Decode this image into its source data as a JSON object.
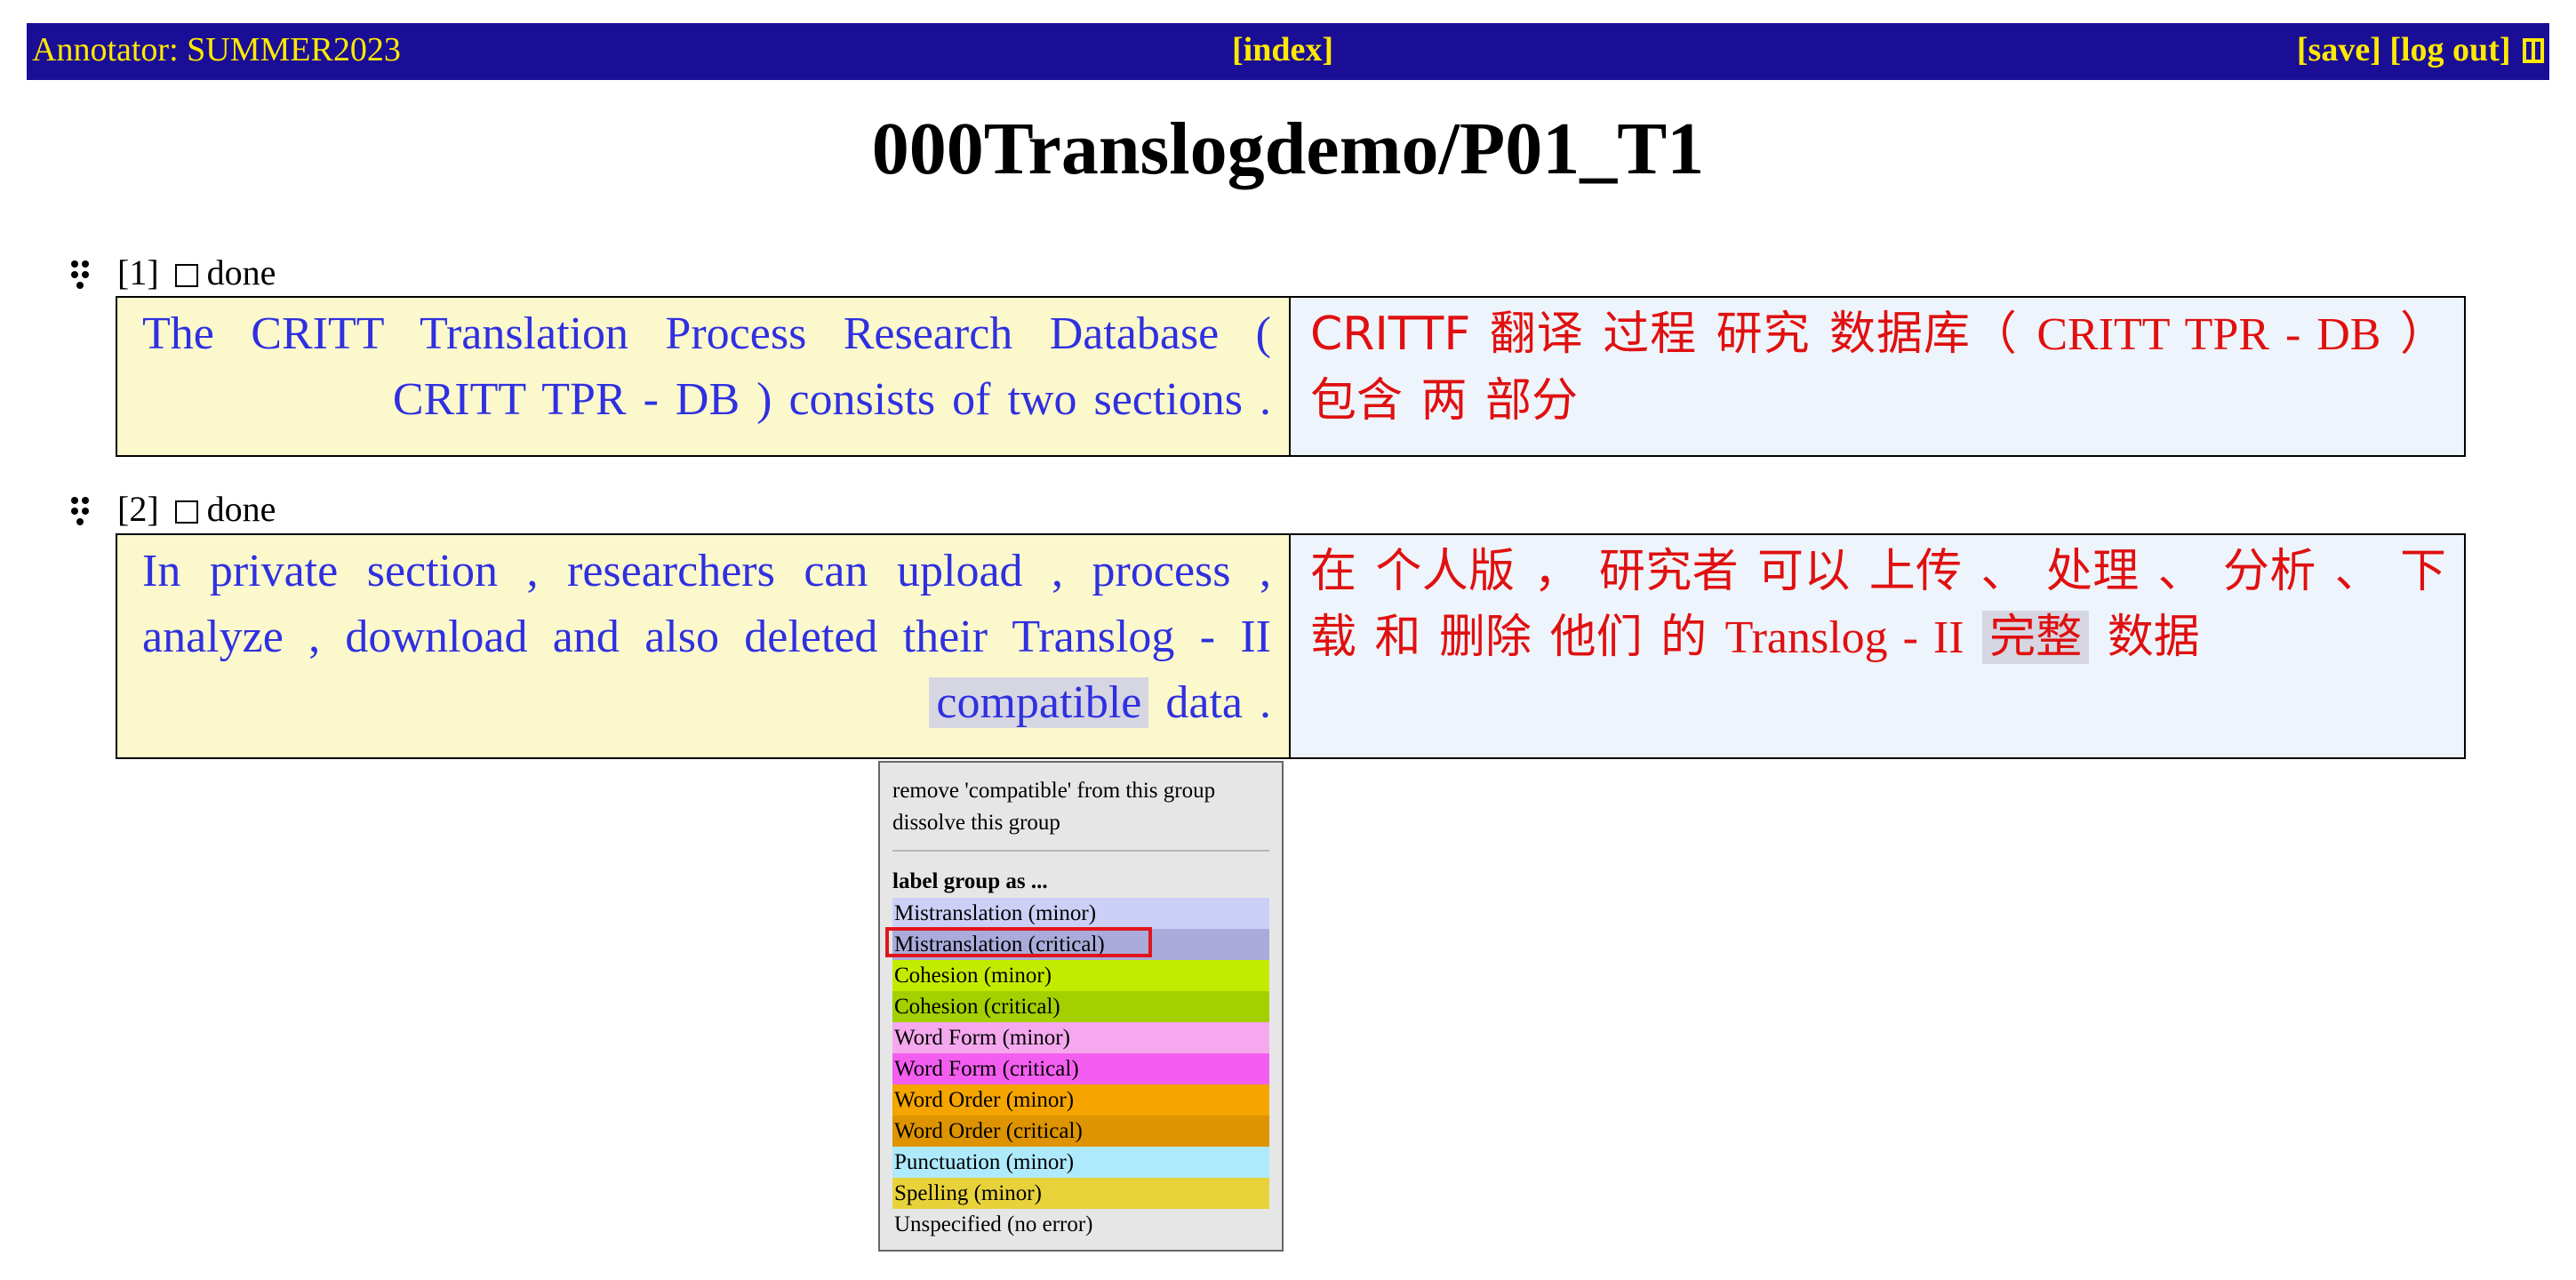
{
  "topbar": {
    "annotator": "Annotator: SUMMER2023",
    "index": "[index]",
    "save": "[save]",
    "logout": "[log out]",
    "pane_icon": "split-pane-icon"
  },
  "page_title": "000Translogdemo/P01_T1",
  "segments": [
    {
      "number": "[1]",
      "done_label": "done",
      "source": "The CRITT Translation Process Research Database ( CRITT TPR - DB ) consists of two sections .",
      "target_part1": "CRITTF 翻译 过程 研究 数据库（ ",
      "target_latin": "CRITT TPR - DB",
      "target_part2": " ）包含 两 部分"
    },
    {
      "number": "[2]",
      "done_label": "done",
      "source_before": "In private section , researchers can upload , process , analyze , download and also deleted their Translog - II ",
      "source_highlight": "compatible",
      "source_after": " data .",
      "target_part1": "在 个人版 ， 研究者 可以 上传 、 处理 、 分析 、 下载 和 删除 他们 的 ",
      "target_latin": "Translog - II",
      "target_highlight": "完整",
      "target_part2": " 数据"
    }
  ],
  "context_menu": {
    "remove": "remove 'compatible' from this group",
    "dissolve": "dissolve this group",
    "header": "label group as ...",
    "options": [
      {
        "label": "Mistranslation (minor)",
        "color": "#cccff6"
      },
      {
        "label": "Mistranslation (critical)",
        "color": "#aaaadb"
      },
      {
        "label": "Cohesion (minor)",
        "color": "#c3eb00"
      },
      {
        "label": "Cohesion (critical)",
        "color": "#a4d000"
      },
      {
        "label": "Word Form (minor)",
        "color": "#f5a8ee"
      },
      {
        "label": "Word Form (critical)",
        "color": "#f45ef0"
      },
      {
        "label": "Word Order (minor)",
        "color": "#f5a400"
      },
      {
        "label": "Word Order (critical)",
        "color": "#dd9400"
      },
      {
        "label": "Punctuation (minor)",
        "color": "#aeeafc"
      },
      {
        "label": "Spelling (minor)",
        "color": "#e8d23a"
      },
      {
        "label": "Unspecified (no error)",
        "color": "#e6e6e6"
      }
    ],
    "selected_option": "Mistranslation (critical)"
  }
}
